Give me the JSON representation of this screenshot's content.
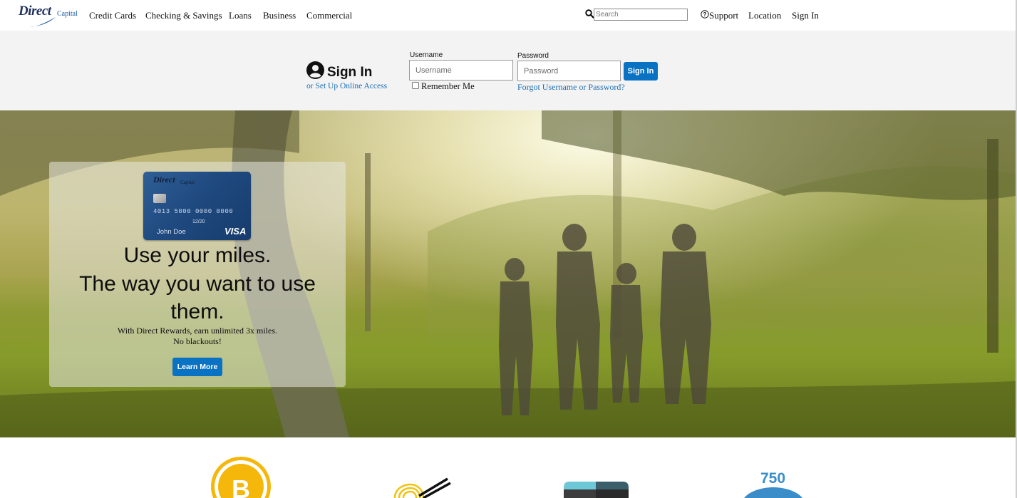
{
  "brand": {
    "logo_main": "Direct",
    "logo_sub": "Capital"
  },
  "nav": {
    "items": [
      "Credit Cards",
      "Checking & Savings",
      "Loans",
      "Business",
      "Commercial"
    ],
    "search_placeholder": "Search",
    "support": "Support",
    "location": "Location",
    "sign_in": "Sign In"
  },
  "signin": {
    "title": "Sign In",
    "setup_link": "or Set Up Online Access",
    "username_label": "Username",
    "username_placeholder": "Username",
    "password_label": "Password",
    "password_placeholder": "Password",
    "remember_me": "Remember Me",
    "forgot_link": "Forgot Username or Password?",
    "button": "Sign In"
  },
  "promo": {
    "card": {
      "brand": "Direct",
      "brand_sub": "Capital",
      "number": "4013 5000 0000 0000",
      "expiry": "12/20",
      "holder": "John Doe",
      "network": "VISA"
    },
    "headline_1": "Use your miles.",
    "headline_2": "The way you want to use",
    "headline_3": "them.",
    "sub_1": "With Direct Rewards, earn unlimited 3x miles.",
    "sub_2": "No blackouts!",
    "button": "Learn More"
  },
  "features": {
    "icons": [
      "bitcoin-icon",
      "noodles-icon",
      "wallet-card-icon",
      "credit-score-icon"
    ],
    "score_value": "750"
  },
  "colors": {
    "accent": "#0a72c3",
    "link": "#1a6fb5",
    "band_bg": "#f3f3f3"
  }
}
